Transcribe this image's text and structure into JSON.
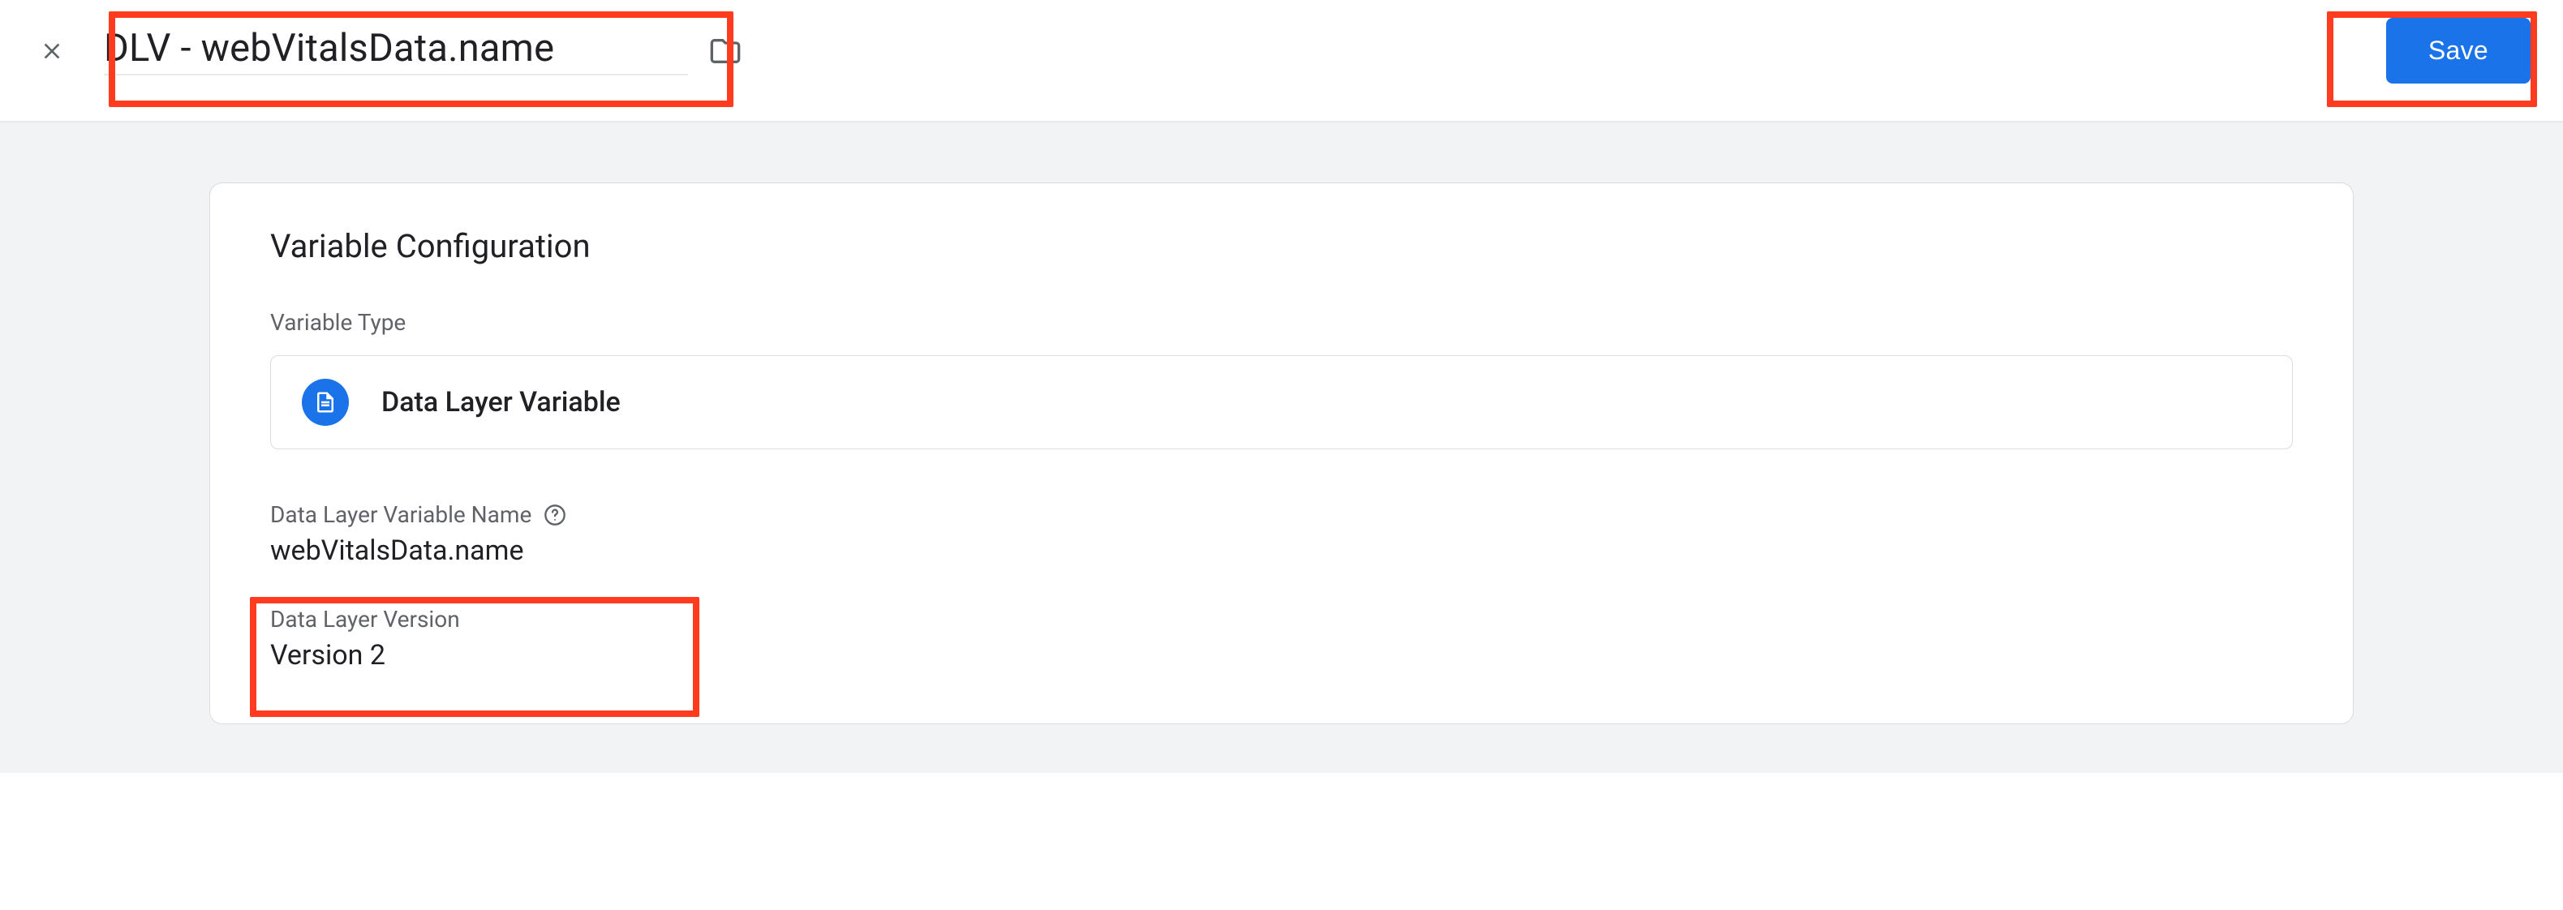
{
  "header": {
    "title": "DLV - webVitalsData.name",
    "save_label": "Save"
  },
  "card": {
    "title": "Variable Configuration",
    "type_section_label": "Variable Type",
    "type_name": "Data Layer Variable",
    "fields": {
      "dlv_name_label": "Data Layer Variable Name",
      "dlv_name_value": "webVitalsData.name",
      "dlv_version_label": "Data Layer Version",
      "dlv_version_value": "Version 2"
    }
  },
  "colors": {
    "primary": "#1a73e8",
    "highlight": "#ff3b1f",
    "text": "#202124",
    "muted": "#5f6368",
    "canvas": "#f1f3f4",
    "border": "#dadce0"
  }
}
